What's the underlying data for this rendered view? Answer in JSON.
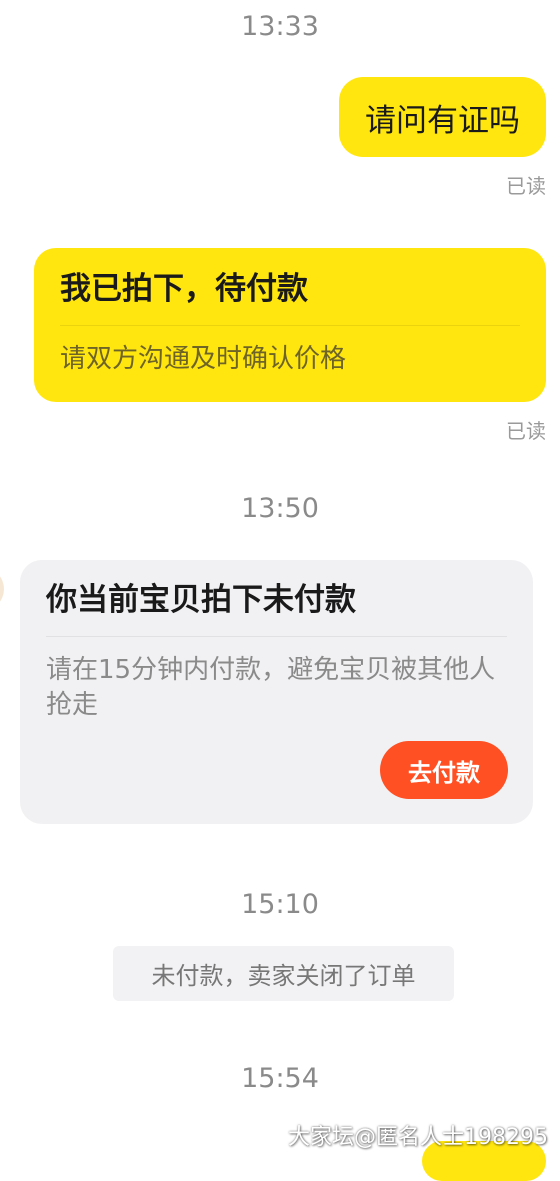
{
  "timestamps": [
    "13:33",
    "13:50",
    "15:10",
    "15:54"
  ],
  "msg_question": "请问有证吗",
  "read_label": "已读",
  "order_card": {
    "title": "我已拍下，待付款",
    "subtitle": "请双方沟通及时确认价格"
  },
  "reminder_card": {
    "title": "你当前宝贝拍下未付款",
    "subtitle": "请在15分钟内付款，避免宝贝被其他人抢走",
    "button": "去付款"
  },
  "system_notice": "未付款，卖家关闭了订单",
  "watermark": "大家坛@匿名人士198295",
  "colors": {
    "bubble_yellow": "#ffe60f",
    "pay_button": "#ff5024",
    "card_gray": "#f1f1f3"
  }
}
